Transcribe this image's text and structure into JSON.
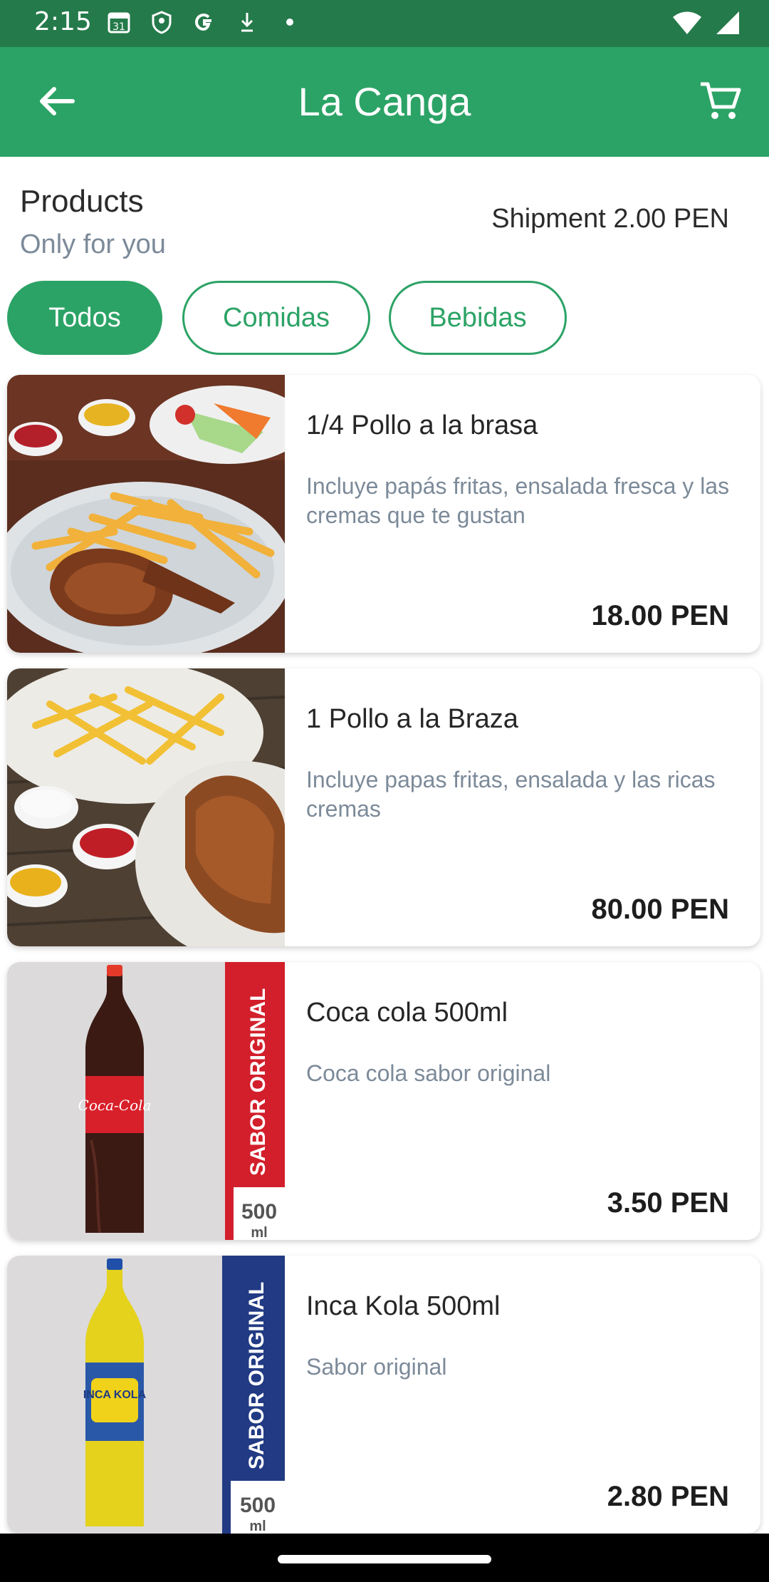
{
  "status_bar": {
    "time": "2:15",
    "icons": [
      "calendar-icon",
      "shield-icon",
      "google-icon",
      "download-icon",
      "dot-icon"
    ],
    "right_icons": [
      "wifi-icon",
      "signal-icon"
    ]
  },
  "app_bar": {
    "title": "La Canga",
    "back_icon": "back-arrow-icon",
    "cart_icon": "cart-icon"
  },
  "header": {
    "heading": "Products",
    "subheading": "Only for you",
    "shipment": "Shipment 2.00 PEN"
  },
  "filters": {
    "chips": [
      {
        "label": "Todos",
        "active": true
      },
      {
        "label": "Comidas",
        "active": false
      },
      {
        "label": "Bebidas",
        "active": false
      }
    ]
  },
  "products": [
    {
      "name": "1/4 Pollo a la brasa",
      "description": "Incluye papás fritas, ensalada fresca y las cremas que te gustan",
      "price": "18.00 PEN",
      "image": "chicken-fries-plate"
    },
    {
      "name": "1 Pollo a la Braza",
      "description": "Incluye papas fritas, ensalada y las ricas cremas",
      "price": "80.00 PEN",
      "image": "whole-chicken-plate"
    },
    {
      "name": "Coca cola 500ml",
      "description": "Coca cola sabor original",
      "price": "3.50 PEN",
      "image": "coca-cola-bottle",
      "banner_text": "SABOR ORIGINAL",
      "size_text": "500",
      "unit_text": "ml",
      "label_text": "Coca-Cola"
    },
    {
      "name": "Inca Kola 500ml",
      "description": "Sabor original",
      "price": "2.80 PEN",
      "image": "inca-kola-bottle",
      "banner_text": "SABOR ORIGINAL",
      "size_text": "500",
      "unit_text": "ml",
      "label_text": "INCA KOLA"
    }
  ],
  "colors": {
    "status_bar": "#247a4a",
    "app_bar": "#2ca366",
    "accent": "#2ca366",
    "subtle_text": "#7c8a99"
  }
}
